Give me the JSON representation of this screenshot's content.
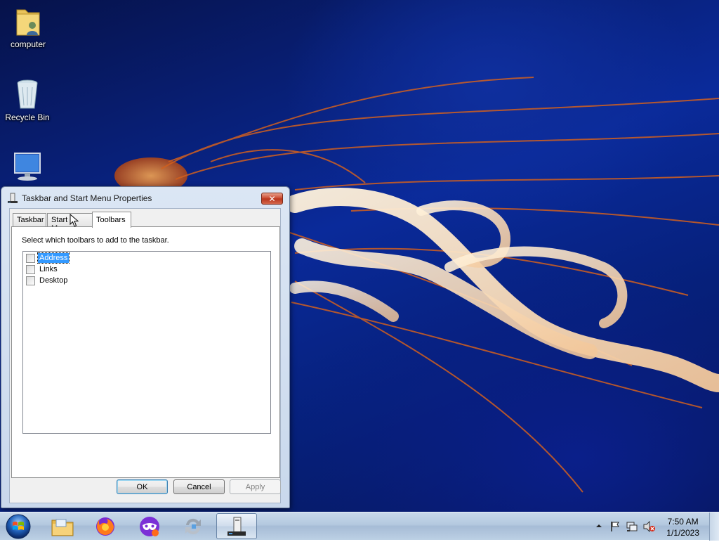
{
  "desktop": {
    "icons": [
      {
        "label": "computer",
        "icon": "user-folder-icon"
      },
      {
        "label": "Recycle Bin",
        "icon": "recycle-bin-icon"
      },
      {
        "label": "",
        "icon": "monitor-icon"
      }
    ]
  },
  "dialog": {
    "title": "Taskbar and Start Menu Properties",
    "close_glyph": "✕",
    "tabs": [
      {
        "label": "Taskbar",
        "active": false
      },
      {
        "label": "Start Menu",
        "active": false
      },
      {
        "label": "Toolbars",
        "active": true
      }
    ],
    "instructions": "Select which toolbars to add to the taskbar.",
    "toolbar_items": [
      {
        "label": "Address",
        "checked": false,
        "selected": true
      },
      {
        "label": "Links",
        "checked": false,
        "selected": false
      },
      {
        "label": "Desktop",
        "checked": false,
        "selected": false
      }
    ],
    "buttons": {
      "ok": "OK",
      "cancel": "Cancel",
      "apply": "Apply"
    }
  },
  "taskbar": {
    "apps": [
      {
        "name": "windows-explorer",
        "icon": "file-explorer-icon",
        "active": false
      },
      {
        "name": "firefox",
        "icon": "firefox-icon",
        "active": false
      },
      {
        "name": "private-browser",
        "icon": "mask-icon",
        "active": false
      },
      {
        "name": "sync-tool",
        "icon": "sync-icon",
        "active": false
      },
      {
        "name": "taskbar-properties",
        "icon": "taskbar-properties-icon",
        "active": true
      }
    ],
    "clock": {
      "time": "7:50 AM",
      "date": "1/1/2023"
    },
    "tray_icons": [
      "show-hidden-icons-arrow",
      "action-center-flag-icon",
      "network-icon",
      "volume-muted-icon"
    ]
  },
  "colors": {
    "selection": "#3399ff",
    "desktop_blue": "#0a2a9a",
    "jellyfish_orange": "#e07a30",
    "close_red": "#c8442a"
  }
}
